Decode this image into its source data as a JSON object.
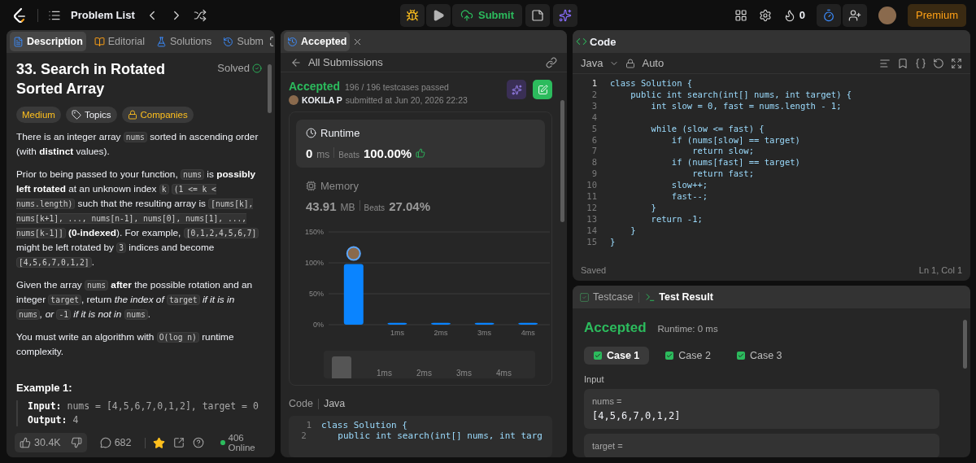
{
  "top_bar": {
    "problem_list": "Problem List",
    "submit": "Submit",
    "streak": "0",
    "premium": "Premium"
  },
  "left_panel": {
    "tabs": [
      {
        "label": "Description",
        "selected": true
      },
      {
        "label": "Editorial",
        "selected": false
      },
      {
        "label": "Solutions",
        "selected": false
      },
      {
        "label": "Subm",
        "selected": false
      }
    ],
    "title": "33. Search in Rotated Sorted Array",
    "status": "Solved",
    "tags": [
      {
        "label": "Medium",
        "kind": "difficulty"
      },
      {
        "label": "Topics",
        "kind": "topics"
      },
      {
        "label": "Companies",
        "kind": "companies"
      }
    ],
    "paragraphs": [
      [
        {
          "kind": "text",
          "text": "There is an integer array "
        },
        {
          "kind": "code",
          "text": "nums"
        },
        {
          "kind": "text",
          "text": " sorted in ascending order (with "
        },
        {
          "kind": "bold",
          "text": "distinct"
        },
        {
          "kind": "text",
          "text": " values)."
        }
      ],
      [
        {
          "kind": "text",
          "text": "Prior to being passed to your function, "
        },
        {
          "kind": "code",
          "text": "nums"
        },
        {
          "kind": "text",
          "text": " is "
        },
        {
          "kind": "bold",
          "text": "possibly left rotated"
        },
        {
          "kind": "text",
          "text": " at an unknown index "
        },
        {
          "kind": "code",
          "text": "k"
        },
        {
          "kind": "gap"
        },
        {
          "kind": "code",
          "text": "(1 <= k < nums.length)"
        },
        {
          "kind": "text",
          "text": " such that the resulting array is "
        },
        {
          "kind": "code",
          "text": "[nums[k], nums[k+1], ..., nums[n-1], nums[0], nums[1], ..., nums[k-1]]"
        },
        {
          "kind": "gap"
        },
        {
          "kind": "bold",
          "text": "(0-indexed"
        },
        {
          "kind": "text",
          "text": "). For example, "
        },
        {
          "kind": "code",
          "text": "[0,1,2,4,5,6,7]"
        },
        {
          "kind": "text",
          "text": " might be left rotated by "
        },
        {
          "kind": "code",
          "text": "3"
        },
        {
          "kind": "text",
          "text": " indices and become "
        },
        {
          "kind": "code",
          "text": "[4,5,6,7,0,1,2]"
        },
        {
          "kind": "text",
          "text": "."
        }
      ],
      [
        {
          "kind": "text",
          "text": "Given the array "
        },
        {
          "kind": "code",
          "text": "nums"
        },
        {
          "kind": "gap"
        },
        {
          "kind": "bold",
          "text": "after"
        },
        {
          "kind": "text",
          "text": " the possible rotation and an integer "
        },
        {
          "kind": "code",
          "text": "target"
        },
        {
          "kind": "text",
          "text": ", return "
        },
        {
          "kind": "italic",
          "text": "the index of "
        },
        {
          "kind": "code",
          "text": "target"
        },
        {
          "kind": "italic",
          "text": " if it is in "
        },
        {
          "kind": "code",
          "text": "nums"
        },
        {
          "kind": "italic",
          "text": ", or "
        },
        {
          "kind": "code",
          "text": "-1"
        },
        {
          "kind": "italic",
          "text": " if it is not in "
        },
        {
          "kind": "code",
          "text": "nums"
        },
        {
          "kind": "text",
          "text": "."
        }
      ],
      [
        {
          "kind": "text",
          "text": "You must write an algorithm with "
        },
        {
          "kind": "code",
          "text": "O(log n)"
        },
        {
          "kind": "text",
          "text": " runtime complexity."
        }
      ]
    ],
    "example_title": "Example 1:",
    "example_lines": [
      {
        "label": "Input:",
        "value": "nums = [4,5,6,7,0,1,2], target = 0"
      },
      {
        "label": "Output:",
        "value": "4"
      }
    ],
    "likes": "30.4K",
    "comments": "682",
    "starred": true,
    "online": "406 Online"
  },
  "middle_panel": {
    "tab": "Accepted",
    "back_link": "All Submissions",
    "verdict": "Accepted",
    "testcases": "196 / 196 testcases passed",
    "user": "KOKILA P",
    "submitted": "submitted at Jun 20, 2026 22:23",
    "stats": [
      {
        "kind": "runtime",
        "label": "Runtime",
        "selected": true,
        "value": "0",
        "unit": "ms",
        "beats_label": "Beats",
        "beats": "100.00%"
      },
      {
        "kind": "memory",
        "label": "Memory",
        "selected": false,
        "value": "43.91",
        "unit": "MB",
        "beats_label": "Beats",
        "beats": "27.04%"
      }
    ],
    "chart_data": {
      "type": "bar",
      "categories": [
        null,
        "1ms",
        "2ms",
        "3ms",
        "4ms"
      ],
      "values": [
        98,
        3,
        3,
        3,
        3
      ],
      "ylim": [
        0,
        150
      ],
      "yticks": [
        {
          "value": 0,
          "label": "0%"
        },
        {
          "value": 50,
          "label": "50%"
        },
        {
          "value": 100,
          "label": "100%"
        },
        {
          "value": 150,
          "label": "150%"
        }
      ]
    },
    "navigator_labels": [
      "1ms",
      "2ms",
      "3ms",
      "4ms"
    ],
    "code_label": "Code",
    "language": "Java",
    "code_lines": [
      {
        "number": "1",
        "text": "class Solution {"
      },
      {
        "number": "2",
        "text": "    public int search(int[] nums, int targ"
      }
    ]
  },
  "code_panel": {
    "title": "Code",
    "language": "Java",
    "mode": "Auto",
    "lines": [
      {
        "number": "1",
        "text": "class Solution {"
      },
      {
        "number": "2",
        "text": "    public int search(int[] nums, int target) {"
      },
      {
        "number": "3",
        "text": "        int slow = 0, fast = nums.length - 1;"
      },
      {
        "number": "4"
      },
      {
        "number": "5",
        "text": "        while (slow <= fast) {"
      },
      {
        "number": "6",
        "text": "            if (nums[slow] == target)"
      },
      {
        "number": "7",
        "text": "                return slow;"
      },
      {
        "number": "8",
        "text": "            if (nums[fast] == target)"
      },
      {
        "number": "9",
        "text": "                return fast;"
      },
      {
        "number": "10",
        "text": "            slow++;"
      },
      {
        "number": "11",
        "text": "            fast--;"
      },
      {
        "number": "12",
        "text": "        }"
      },
      {
        "number": "13",
        "text": "        return -1;"
      },
      {
        "number": "14",
        "text": "    }"
      },
      {
        "number": "15",
        "text": "}"
      }
    ],
    "saved": "Saved",
    "cursor": "Ln 1, Col 1"
  },
  "test_panel": {
    "tabs": [
      {
        "label": "Testcase",
        "selected": false
      },
      {
        "label": "Test Result",
        "selected": true
      }
    ],
    "verdict": "Accepted",
    "runtime": "Runtime: 0 ms",
    "cases": [
      {
        "label": "Case 1",
        "selected": true,
        "passed": true
      },
      {
        "label": "Case 2",
        "selected": false,
        "passed": true
      },
      {
        "label": "Case 3",
        "selected": false,
        "passed": true
      }
    ],
    "input_label": "Input",
    "inputs": [
      {
        "name": "nums =",
        "value": "[4,5,6,7,0,1,2]"
      },
      {
        "name": "target ="
      }
    ]
  }
}
